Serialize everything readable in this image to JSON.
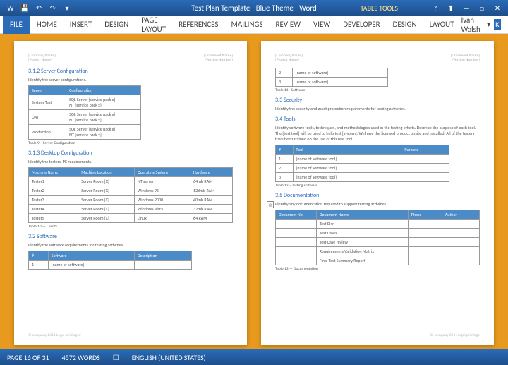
{
  "title": "Test Plan Template - Blue Theme - Word",
  "tabletools": "TABLE TOOLS",
  "qat": {
    "word": "W",
    "save": "💾",
    "undo": "↶",
    "redo": "↷",
    "down": "▾"
  },
  "win": {
    "help": "?",
    "up": "⬆",
    "min": "—",
    "max": "□",
    "close": "✕"
  },
  "ribbon": {
    "file": "FILE",
    "tabs": [
      "HOME",
      "INSERT",
      "DESIGN",
      "PAGE LAYOUT",
      "REFERENCES",
      "MAILINGS",
      "REVIEW",
      "VIEW",
      "DEVELOPER",
      "DESIGN",
      "LAYOUT"
    ]
  },
  "user": {
    "name": "Ivan Walsh",
    "arrow": "▾",
    "badge": "K"
  },
  "hdr": {
    "company": "[Company Name]",
    "project": "[Project Name]",
    "docname": "[Document Name]",
    "version": "[Version Number]"
  },
  "p1": {
    "s312": "3.1.2    Server Configuration",
    "s312_body": "Identify the server configurations.",
    "t9": {
      "h": [
        "Server",
        "Configuration"
      ],
      "r": [
        [
          "System Test",
          "SQL Server [service pack x]\nNT [service pack x]"
        ],
        [
          "UAT",
          "SQL Server [service pack x]\nNT [service pack x]"
        ],
        [
          "Production",
          "SQL Server [service pack x]\nNT [service pack x]"
        ]
      ],
      "cap": "Table 9—Server Configuration"
    },
    "s313": "3.1.3    Desktop Configuration",
    "s313_body": "Identify the testers' PC requirements.",
    "t10": {
      "h": [
        "Machine Name",
        "Machine Location",
        "Operating System",
        "Hardware"
      ],
      "r": [
        [
          "Tester1",
          "Server Room [X]",
          "NT server",
          "64mb RAM"
        ],
        [
          "Tester2",
          "Server Room [X]",
          "Windows 95",
          "128mb RAM"
        ],
        [
          "Tester3",
          "Server Room [X]",
          "Windows 2000",
          "40mb RAM"
        ],
        [
          "Tester4",
          "Server Room [X]",
          "Windows Vista",
          "32mb RAM"
        ],
        [
          "Tester5",
          "Server Room [X]",
          "Linux",
          "64 RAM"
        ]
      ],
      "cap": "Table 10 — Clients"
    },
    "s32": "3.2      Software",
    "s32_body": "Identify the software requirements for testing activities.",
    "t_sw": {
      "h": [
        "#",
        "Software",
        "Description"
      ],
      "r": [
        [
          "1",
          "[name of software]",
          ""
        ]
      ]
    }
  },
  "p2": {
    "t11": {
      "r": [
        [
          "2",
          "[name of software]"
        ],
        [
          "3",
          "[name of software]"
        ]
      ],
      "cap": "Table 11 –Software"
    },
    "s33": "3.3      Security",
    "s33_body": "Identify the security and asset protection requirements for testing activities.",
    "s34": "3.4      Tools",
    "s34_body": "Identify software tools, techniques, and methodologies used in the testing efforts. Describe the purpose of each tool. The [test tool] will be used to help test [system]. We have the licensed product onsite and installed. All of the testers have been trained on the use of this test tool.",
    "t12": {
      "h": [
        "#",
        "Tool",
        "Purpose"
      ],
      "r": [
        [
          "1",
          "[name of software tool]",
          ""
        ],
        [
          "2",
          "[name of software tool]",
          ""
        ],
        [
          "3",
          "[name of software tool]",
          ""
        ]
      ],
      "cap": "Table 12 – Testing software"
    },
    "s35": "3.5      Documentation",
    "s35_body": "Identify any documentation required to support testing activities.",
    "t13": {
      "h": [
        "Document No.",
        "Document Name",
        "Phase",
        "Author"
      ],
      "r": [
        [
          "",
          "Test Plan",
          "",
          ""
        ],
        [
          "",
          "Test Cases",
          "",
          ""
        ],
        [
          "",
          "Test Case review",
          "",
          ""
        ],
        [
          "",
          "Requirements Validation Matrix",
          "",
          ""
        ],
        [
          "",
          "Final Test Summary Report",
          "",
          ""
        ]
      ],
      "cap": "Table 13 — Documentation"
    }
  },
  "footer": {
    "left": "© company 2011 Legal privileged",
    "right": "© company 2011  legal privilege"
  },
  "status": {
    "page": "PAGE 16 OF 31",
    "words": "4572 WORDS",
    "lang": "ENGLISH (UNITED STATES)",
    "box": "☐"
  },
  "anchor": "⊕"
}
